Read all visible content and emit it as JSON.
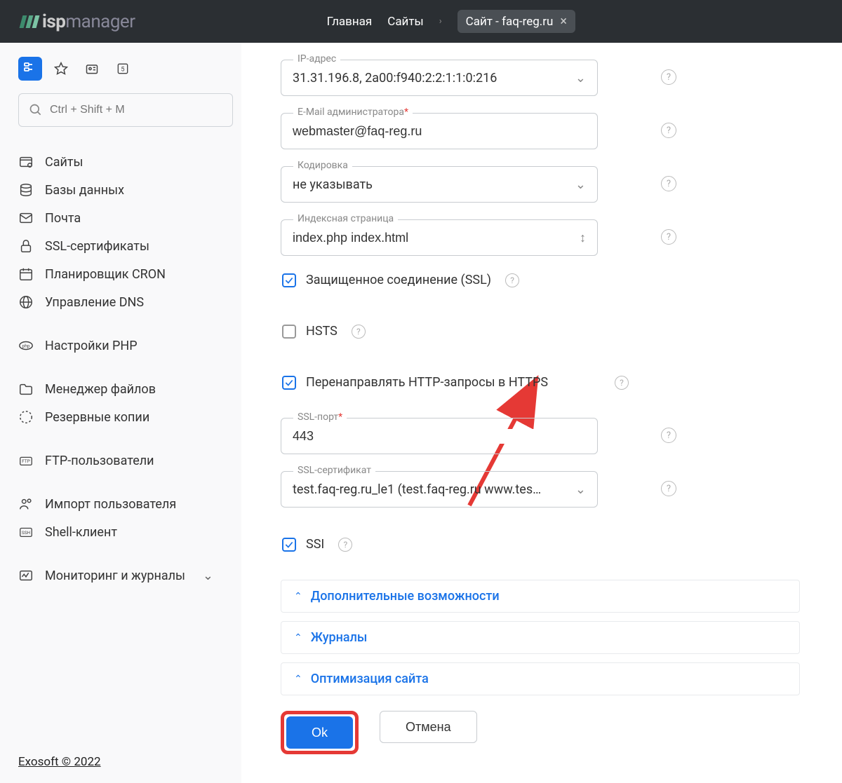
{
  "header": {
    "logo_bold": "isp",
    "logo_light": "manager",
    "breadcrumbs": {
      "home": "Главная",
      "sites": "Сайты",
      "current": "Сайт - faq-reg.ru"
    }
  },
  "sidebar": {
    "search_placeholder": "Ctrl + Shift + M",
    "items": [
      {
        "label": "Сайты",
        "icon": "sites"
      },
      {
        "label": "Базы данных",
        "icon": "database"
      },
      {
        "label": "Почта",
        "icon": "mail"
      },
      {
        "label": "SSL-сертификаты",
        "icon": "lock"
      },
      {
        "label": "Планировщик CRON",
        "icon": "calendar"
      },
      {
        "label": "Управление DNS",
        "icon": "globe"
      }
    ],
    "items2": [
      {
        "label": "Настройки PHP",
        "icon": "php"
      }
    ],
    "items3": [
      {
        "label": "Менеджер файлов",
        "icon": "folder"
      },
      {
        "label": "Резервные копии",
        "icon": "backup"
      }
    ],
    "items4": [
      {
        "label": "FTP-пользователи",
        "icon": "ftp"
      }
    ],
    "items5": [
      {
        "label": "Импорт пользователя",
        "icon": "users"
      },
      {
        "label": "Shell-клиент",
        "icon": "ssh"
      }
    ],
    "items6": [
      {
        "label": "Мониторинг и журналы",
        "icon": "monitor",
        "expandable": true
      }
    ],
    "footer": "Exosoft © 2022"
  },
  "form": {
    "ip_label": "IP-адрес",
    "ip_value": "31.31.196.8, 2a00:f940:2:2:1:1:0:216",
    "email_label": "E-Mail администратора",
    "email_value": "webmaster@faq-reg.ru",
    "encoding_label": "Кодировка",
    "encoding_value": "не указывать",
    "index_label": "Индексная страница",
    "index_value": "index.php index.html",
    "ssl_check": "Защищенное соединение (SSL)",
    "hsts_check": "HSTS",
    "redirect_check": "Перенаправлять HTTP-запросы в HTTPS",
    "sslport_label": "SSL-порт",
    "sslport_value": "443",
    "sslcert_label": "SSL-сертификат",
    "sslcert_value": "test.faq-reg.ru_le1 (test.faq-reg.ru www.tes…",
    "ssi_check": "SSI",
    "acc1": "Дополнительные возможности",
    "acc2": "Журналы",
    "acc3": "Оптимизация сайта",
    "ok": "Ok",
    "cancel": "Отмена"
  }
}
